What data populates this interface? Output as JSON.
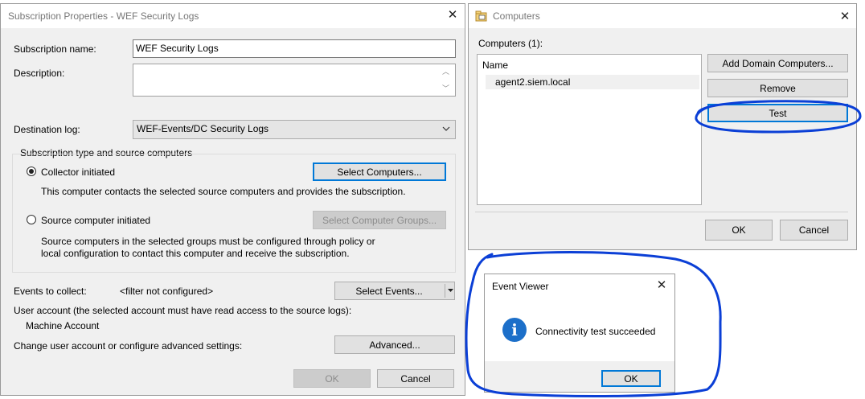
{
  "subscription_dialog": {
    "title": "Subscription Properties - WEF Security Logs",
    "close_glyph": "✕",
    "name_label": "Subscription name:",
    "name_value": "WEF Security Logs",
    "description_label": "Description:",
    "description_value": "",
    "destination_label": "Destination log:",
    "destination_value": "WEF-Events/DC Security Logs",
    "type_group_label": "Subscription type and source computers",
    "collector_label": "Collector initiated",
    "collector_selected": true,
    "select_computers_button": "Select Computers...",
    "collector_desc": "This computer contacts the selected source computers and provides the subscription.",
    "source_label": "Source computer initiated",
    "select_groups_button": "Select Computer Groups...",
    "source_desc_line1": "Source computers in the selected groups must be configured through policy or",
    "source_desc_line2": "local configuration to contact this computer and receive the subscription.",
    "events_label": "Events to collect:",
    "events_value": "<filter not configured>",
    "select_events_button": "Select Events...",
    "user_account_label": "User account (the selected account must have read access to the source logs):",
    "user_account_value": "Machine Account",
    "advanced_label": "Change user account or configure advanced settings:",
    "advanced_button": "Advanced...",
    "ok_button": "OK",
    "cancel_button": "Cancel"
  },
  "computers_dialog": {
    "title": "Computers",
    "close_glyph": "✕",
    "count_label": "Computers (1):",
    "column_header": "Name",
    "items": [
      "agent2.siem.local"
    ],
    "add_button": "Add Domain Computers...",
    "remove_button": "Remove",
    "test_button": "Test",
    "ok_button": "OK",
    "cancel_button": "Cancel"
  },
  "event_viewer_dialog": {
    "title": "Event Viewer",
    "close_glyph": "✕",
    "info_glyph": "i",
    "message": "Connectivity test succeeded",
    "ok_button": "OK"
  },
  "colors": {
    "annotation": "#0b3fd6",
    "focus_border": "#0078d7",
    "info_icon": "#1c6fc9"
  }
}
